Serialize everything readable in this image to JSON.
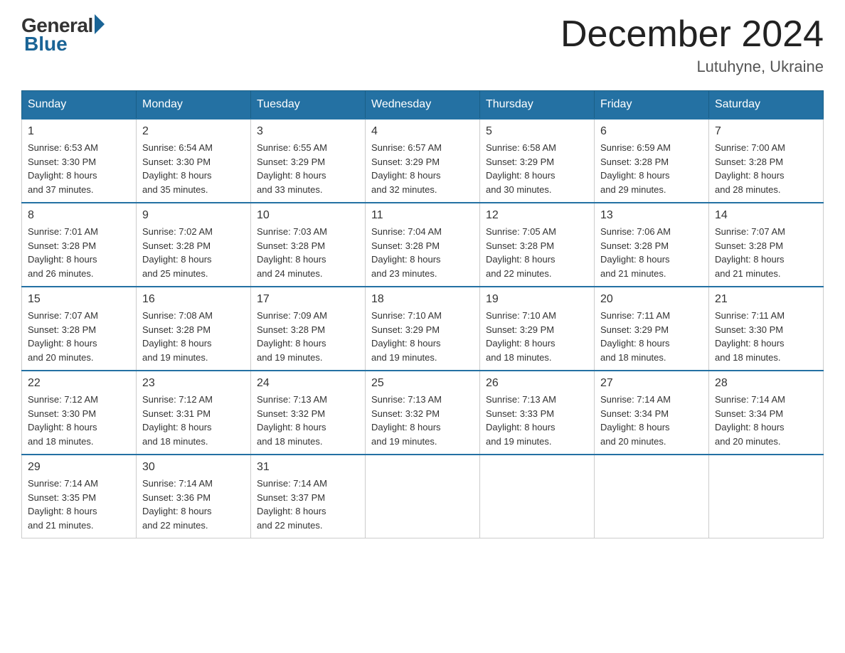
{
  "header": {
    "logo_general": "General",
    "logo_blue": "Blue",
    "month_title": "December 2024",
    "location": "Lutuhyne, Ukraine"
  },
  "days_of_week": [
    "Sunday",
    "Monday",
    "Tuesday",
    "Wednesday",
    "Thursday",
    "Friday",
    "Saturday"
  ],
  "weeks": [
    [
      {
        "day": "1",
        "info": "Sunrise: 6:53 AM\nSunset: 3:30 PM\nDaylight: 8 hours\nand 37 minutes."
      },
      {
        "day": "2",
        "info": "Sunrise: 6:54 AM\nSunset: 3:30 PM\nDaylight: 8 hours\nand 35 minutes."
      },
      {
        "day": "3",
        "info": "Sunrise: 6:55 AM\nSunset: 3:29 PM\nDaylight: 8 hours\nand 33 minutes."
      },
      {
        "day": "4",
        "info": "Sunrise: 6:57 AM\nSunset: 3:29 PM\nDaylight: 8 hours\nand 32 minutes."
      },
      {
        "day": "5",
        "info": "Sunrise: 6:58 AM\nSunset: 3:29 PM\nDaylight: 8 hours\nand 30 minutes."
      },
      {
        "day": "6",
        "info": "Sunrise: 6:59 AM\nSunset: 3:28 PM\nDaylight: 8 hours\nand 29 minutes."
      },
      {
        "day": "7",
        "info": "Sunrise: 7:00 AM\nSunset: 3:28 PM\nDaylight: 8 hours\nand 28 minutes."
      }
    ],
    [
      {
        "day": "8",
        "info": "Sunrise: 7:01 AM\nSunset: 3:28 PM\nDaylight: 8 hours\nand 26 minutes."
      },
      {
        "day": "9",
        "info": "Sunrise: 7:02 AM\nSunset: 3:28 PM\nDaylight: 8 hours\nand 25 minutes."
      },
      {
        "day": "10",
        "info": "Sunrise: 7:03 AM\nSunset: 3:28 PM\nDaylight: 8 hours\nand 24 minutes."
      },
      {
        "day": "11",
        "info": "Sunrise: 7:04 AM\nSunset: 3:28 PM\nDaylight: 8 hours\nand 23 minutes."
      },
      {
        "day": "12",
        "info": "Sunrise: 7:05 AM\nSunset: 3:28 PM\nDaylight: 8 hours\nand 22 minutes."
      },
      {
        "day": "13",
        "info": "Sunrise: 7:06 AM\nSunset: 3:28 PM\nDaylight: 8 hours\nand 21 minutes."
      },
      {
        "day": "14",
        "info": "Sunrise: 7:07 AM\nSunset: 3:28 PM\nDaylight: 8 hours\nand 21 minutes."
      }
    ],
    [
      {
        "day": "15",
        "info": "Sunrise: 7:07 AM\nSunset: 3:28 PM\nDaylight: 8 hours\nand 20 minutes."
      },
      {
        "day": "16",
        "info": "Sunrise: 7:08 AM\nSunset: 3:28 PM\nDaylight: 8 hours\nand 19 minutes."
      },
      {
        "day": "17",
        "info": "Sunrise: 7:09 AM\nSunset: 3:28 PM\nDaylight: 8 hours\nand 19 minutes."
      },
      {
        "day": "18",
        "info": "Sunrise: 7:10 AM\nSunset: 3:29 PM\nDaylight: 8 hours\nand 19 minutes."
      },
      {
        "day": "19",
        "info": "Sunrise: 7:10 AM\nSunset: 3:29 PM\nDaylight: 8 hours\nand 18 minutes."
      },
      {
        "day": "20",
        "info": "Sunrise: 7:11 AM\nSunset: 3:29 PM\nDaylight: 8 hours\nand 18 minutes."
      },
      {
        "day": "21",
        "info": "Sunrise: 7:11 AM\nSunset: 3:30 PM\nDaylight: 8 hours\nand 18 minutes."
      }
    ],
    [
      {
        "day": "22",
        "info": "Sunrise: 7:12 AM\nSunset: 3:30 PM\nDaylight: 8 hours\nand 18 minutes."
      },
      {
        "day": "23",
        "info": "Sunrise: 7:12 AM\nSunset: 3:31 PM\nDaylight: 8 hours\nand 18 minutes."
      },
      {
        "day": "24",
        "info": "Sunrise: 7:13 AM\nSunset: 3:32 PM\nDaylight: 8 hours\nand 18 minutes."
      },
      {
        "day": "25",
        "info": "Sunrise: 7:13 AM\nSunset: 3:32 PM\nDaylight: 8 hours\nand 19 minutes."
      },
      {
        "day": "26",
        "info": "Sunrise: 7:13 AM\nSunset: 3:33 PM\nDaylight: 8 hours\nand 19 minutes."
      },
      {
        "day": "27",
        "info": "Sunrise: 7:14 AM\nSunset: 3:34 PM\nDaylight: 8 hours\nand 20 minutes."
      },
      {
        "day": "28",
        "info": "Sunrise: 7:14 AM\nSunset: 3:34 PM\nDaylight: 8 hours\nand 20 minutes."
      }
    ],
    [
      {
        "day": "29",
        "info": "Sunrise: 7:14 AM\nSunset: 3:35 PM\nDaylight: 8 hours\nand 21 minutes."
      },
      {
        "day": "30",
        "info": "Sunrise: 7:14 AM\nSunset: 3:36 PM\nDaylight: 8 hours\nand 22 minutes."
      },
      {
        "day": "31",
        "info": "Sunrise: 7:14 AM\nSunset: 3:37 PM\nDaylight: 8 hours\nand 22 minutes."
      },
      {
        "day": "",
        "info": ""
      },
      {
        "day": "",
        "info": ""
      },
      {
        "day": "",
        "info": ""
      },
      {
        "day": "",
        "info": ""
      }
    ]
  ]
}
